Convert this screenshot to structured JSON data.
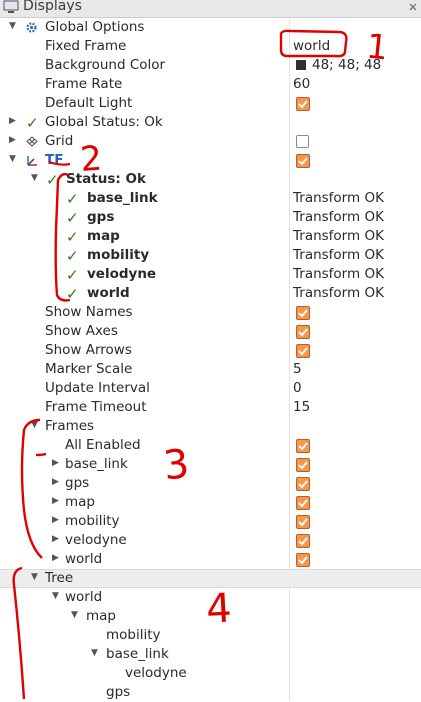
{
  "title": "Displays",
  "rows": {
    "global_options": "Global Options",
    "fixed_frame": {
      "label": "Fixed Frame",
      "value": "world"
    },
    "background_color": {
      "label": "Background Color",
      "value": "48; 48; 48"
    },
    "frame_rate": {
      "label": "Frame Rate",
      "value": "60"
    },
    "default_light": "Default Light",
    "global_status": "Global Status: Ok",
    "grid": "Grid",
    "tf": "TF",
    "status": "Status: Ok",
    "tf_items": [
      {
        "label": "base_link",
        "value": "Transform OK"
      },
      {
        "label": "gps",
        "value": "Transform OK"
      },
      {
        "label": "map",
        "value": "Transform OK"
      },
      {
        "label": "mobility",
        "value": "Transform OK"
      },
      {
        "label": "velodyne",
        "value": "Transform OK"
      },
      {
        "label": "world",
        "value": "Transform OK"
      }
    ],
    "show_names": "Show Names",
    "show_axes": "Show Axes",
    "show_arrows": "Show Arrows",
    "marker_scale": {
      "label": "Marker Scale",
      "value": "5"
    },
    "update_interval": {
      "label": "Update Interval",
      "value": "0"
    },
    "frame_timeout": {
      "label": "Frame Timeout",
      "value": "15"
    },
    "frames": "Frames",
    "all_enabled": "All Enabled",
    "frame_items": [
      "base_link",
      "gps",
      "map",
      "mobility",
      "velodyne",
      "world"
    ],
    "tree": "Tree",
    "tree_items": [
      "world",
      "map",
      "mobility",
      "base_link",
      "velodyne",
      "gps"
    ]
  },
  "annotations": [
    "1",
    "2",
    "3",
    "4"
  ],
  "colors": {
    "checkbox": "#f09a4f",
    "status_ok": "#2f7d18",
    "annotation": "#e00000"
  }
}
